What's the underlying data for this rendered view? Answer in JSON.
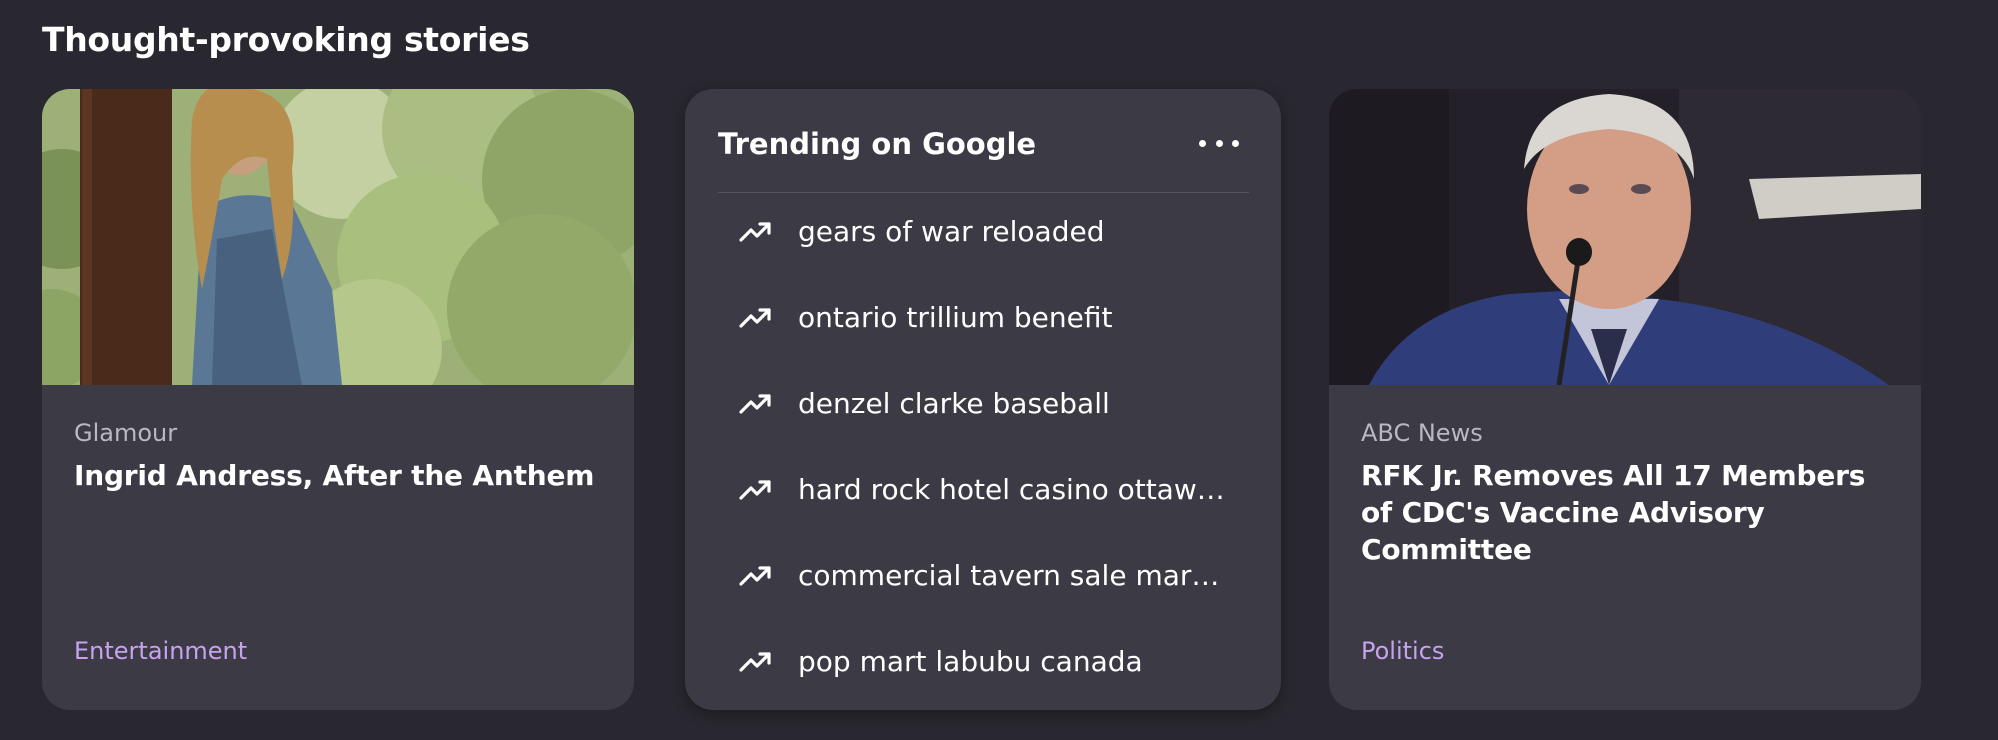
{
  "section": {
    "title": "Thought-provoking stories"
  },
  "cards": [
    {
      "source": "Glamour",
      "title": "Ingrid Andress, After the Anthem",
      "category": "Entertainment"
    },
    {
      "source": "ABC News",
      "title": "RFK Jr. Removes All 17 Members of CDC's Vaccine Advisory Committee",
      "category": "Politics"
    }
  ],
  "trending": {
    "title": "Trending on Google",
    "items": [
      {
        "label": "gears of war reloaded",
        "icon": "trending-up-icon"
      },
      {
        "label": "ontario trillium benefit",
        "icon": "trending-up-icon"
      },
      {
        "label": "denzel clarke baseball",
        "icon": "trending-up-icon"
      },
      {
        "label": "hard rock hotel casino ottawa...",
        "icon": "trending-up-icon"
      },
      {
        "label": "commercial tavern sale maryhill",
        "icon": "trending-up-icon"
      },
      {
        "label": "pop mart labubu canada",
        "icon": "trending-up-icon"
      }
    ]
  },
  "colors": {
    "background": "#292830",
    "card": "#3b3a45",
    "category": "#c7a3ee",
    "source": "#b9b8c0"
  }
}
